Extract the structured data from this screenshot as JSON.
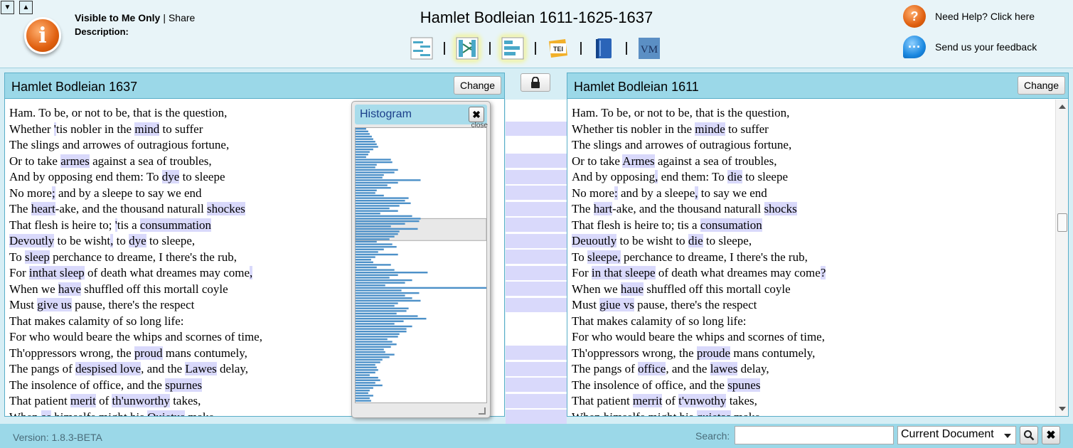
{
  "header": {
    "visibility": "Visible to Me Only",
    "share": "Share",
    "description_label": "Description:",
    "title": "Hamlet Bodleian 1611-1625-1637",
    "help": "Need Help? Click here",
    "feedback": "Send us your feedback",
    "toolbar_icons": [
      "side-by-side-icon",
      "collate-icon",
      "heatmap-icon",
      "tei-icon",
      "book-icon",
      "vm-icon"
    ],
    "tei_label": "TEI",
    "vm_label": "VM"
  },
  "left": {
    "title": "Hamlet Bodleian 1637",
    "change_label": "Change",
    "lines": [
      [
        [
          "Ham. To be, or not to be, that is the question,",
          false
        ]
      ],
      [
        [
          "Whether ",
          false
        ],
        [
          "'",
          true
        ],
        [
          "tis nobler in the ",
          false
        ],
        [
          "mind",
          true
        ],
        [
          " to suffer",
          false
        ]
      ],
      [
        [
          "The slings and arrowes of outragious fortune,",
          false
        ]
      ],
      [
        [
          "Or to take ",
          false
        ],
        [
          "armes",
          true
        ],
        [
          " against a sea of troubles,",
          false
        ]
      ],
      [
        [
          "And by opposing end them: To ",
          false
        ],
        [
          "dye",
          true
        ],
        [
          " to sleepe",
          false
        ]
      ],
      [
        [
          "No more",
          false
        ],
        [
          ";",
          true
        ],
        [
          " and by a sleepe to say we end",
          false
        ]
      ],
      [
        [
          "The ",
          false
        ],
        [
          "heart",
          true
        ],
        [
          "-ake, and the thousand naturall ",
          false
        ],
        [
          "shockes",
          true
        ]
      ],
      [
        [
          "That flesh is heire to; ",
          false
        ],
        [
          "'",
          true
        ],
        [
          "tis a ",
          false
        ],
        [
          "consummation",
          true
        ]
      ],
      [
        [
          "Devoutly",
          true
        ],
        [
          " to be wisht",
          false
        ],
        [
          ",",
          true
        ],
        [
          " to ",
          false
        ],
        [
          "dye",
          true
        ],
        [
          " to sleepe,",
          false
        ]
      ],
      [
        [
          "To ",
          false
        ],
        [
          "sleep",
          true
        ],
        [
          " perchance to dreame, I there's the rub,",
          false
        ]
      ],
      [
        [
          "For ",
          false
        ],
        [
          "inthat sleep",
          true
        ],
        [
          " of death what dreames may come",
          false
        ],
        [
          ",",
          true
        ]
      ],
      [
        [
          "When we ",
          false
        ],
        [
          "have",
          true
        ],
        [
          " shuffled off this mortall coyle",
          false
        ]
      ],
      [
        [
          "Must ",
          false
        ],
        [
          "give us",
          true
        ],
        [
          " pause, there's the respect",
          false
        ]
      ],
      [
        [
          "That makes calamity of so long life:",
          false
        ]
      ],
      [
        [
          "For who would beare the whips and scornes of time,",
          false
        ]
      ],
      [
        [
          "Th'oppressors wrong, the ",
          false
        ],
        [
          "proud",
          true
        ],
        [
          " mans contumely,",
          false
        ]
      ],
      [
        [
          "The pangs of ",
          false
        ],
        [
          "despised love",
          true
        ],
        [
          ", and the ",
          false
        ],
        [
          "Lawes",
          true
        ],
        [
          " delay,",
          false
        ]
      ],
      [
        [
          "The insolence of office, and the ",
          false
        ],
        [
          "spurnes",
          true
        ]
      ],
      [
        [
          "That patient ",
          false
        ],
        [
          "merit",
          true
        ],
        [
          " of ",
          false
        ],
        [
          "th'unworthy",
          true
        ],
        [
          " takes,",
          false
        ]
      ],
      [
        [
          "When ",
          false
        ],
        [
          "as",
          true
        ],
        [
          " himselfe might his ",
          false
        ],
        [
          "Quietus",
          true
        ],
        [
          " make",
          false
        ]
      ]
    ]
  },
  "right": {
    "title": "Hamlet Bodleian 1611",
    "change_label": "Change",
    "lines": [
      [
        [
          "Ham. To be, or not to be, that is the question,",
          false
        ]
      ],
      [
        [
          "Whether tis nobler in the ",
          false
        ],
        [
          "minde",
          true
        ],
        [
          " to suffer",
          false
        ]
      ],
      [
        [
          "The slings and arrowes of outragious fortune,",
          false
        ]
      ],
      [
        [
          "Or to take ",
          false
        ],
        [
          "Armes",
          true
        ],
        [
          " against a sea of troubles,",
          false
        ]
      ],
      [
        [
          "And by opposing",
          false
        ],
        [
          ",",
          true
        ],
        [
          " end them: To ",
          false
        ],
        [
          "die",
          true
        ],
        [
          " to sleepe",
          false
        ]
      ],
      [
        [
          "No more",
          false
        ],
        [
          ":",
          true
        ],
        [
          " and by a sleepe",
          false
        ],
        [
          ",",
          true
        ],
        [
          " to say we end",
          false
        ]
      ],
      [
        [
          "The ",
          false
        ],
        [
          "hart",
          true
        ],
        [
          "-ake, and the thousand naturall ",
          false
        ],
        [
          "shocks",
          true
        ]
      ],
      [
        [
          "That flesh is heire to; tis a ",
          false
        ],
        [
          "consumation",
          true
        ]
      ],
      [
        [
          "Deuoutly",
          true
        ],
        [
          " to be wisht to ",
          false
        ],
        [
          "die",
          true
        ],
        [
          " to sleepe,",
          false
        ]
      ],
      [
        [
          "To ",
          false
        ],
        [
          "sleepe,",
          true
        ],
        [
          " perchance to dreame, I there's the rub,",
          false
        ]
      ],
      [
        [
          "For ",
          false
        ],
        [
          "in that sleepe",
          true
        ],
        [
          " of death what dreames may come",
          false
        ],
        [
          "?",
          true
        ]
      ],
      [
        [
          "When we ",
          false
        ],
        [
          "haue",
          true
        ],
        [
          " shuffled off this mortall coyle",
          false
        ]
      ],
      [
        [
          "Must ",
          false
        ],
        [
          "giue vs",
          true
        ],
        [
          " pause, there's the respect",
          false
        ]
      ],
      [
        [
          "That makes calamity of so long life:",
          false
        ]
      ],
      [
        [
          "For who would beare the whips and scornes of time,",
          false
        ]
      ],
      [
        [
          "Th'oppressors wrong, the ",
          false
        ],
        [
          "proude",
          true
        ],
        [
          " mans contumely,",
          false
        ]
      ],
      [
        [
          "The pangs of ",
          false
        ],
        [
          "office",
          true
        ],
        [
          ", and the ",
          false
        ],
        [
          "lawes",
          true
        ],
        [
          " delay,",
          false
        ]
      ],
      [
        [
          "The insolence of office, and the ",
          false
        ],
        [
          "spunes",
          true
        ]
      ],
      [
        [
          "That patient ",
          false
        ],
        [
          "merrit",
          true
        ],
        [
          " of ",
          false
        ],
        [
          "t'vnwothy",
          true
        ],
        [
          " takes,",
          false
        ]
      ],
      [
        [
          "When himselfe might his ",
          false
        ],
        [
          "quietas",
          true
        ],
        [
          " make",
          false
        ]
      ]
    ]
  },
  "histogram": {
    "title": "Histogram",
    "close_label": "close",
    "values": [
      15,
      18,
      20,
      23,
      25,
      28,
      30,
      32,
      25,
      20,
      18,
      15,
      50,
      52,
      30,
      28,
      60,
      55,
      40,
      38,
      92,
      60,
      45,
      50,
      30,
      28,
      40,
      75,
      70,
      78,
      62,
      48,
      60,
      35,
      80,
      92,
      90,
      70,
      50,
      88,
      62,
      60,
      55,
      48,
      30,
      52,
      58,
      40,
      32,
      60,
      28,
      22,
      25,
      50,
      30,
      55,
      102,
      60,
      48,
      80,
      70,
      42,
      185,
      65,
      90,
      70,
      80,
      92,
      60,
      55,
      75,
      72,
      58,
      88,
      100,
      68,
      55,
      80,
      72,
      72,
      62,
      60,
      45,
      52,
      58,
      50,
      40,
      42,
      55,
      48,
      38,
      35,
      28,
      30,
      32,
      28,
      20,
      32,
      35,
      28,
      38,
      25,
      20,
      18,
      25,
      20,
      22
    ],
    "max": 185,
    "selection": [
      0.33,
      0.41
    ]
  },
  "center": {
    "lock_icon": "lock-icon",
    "connector_rows": [
      1,
      3,
      4,
      5,
      6,
      7,
      8,
      9,
      10,
      11,
      12,
      15,
      16,
      17,
      18,
      19
    ]
  },
  "footer": {
    "version": "Version: 1.8.3-BETA",
    "search_label": "Search:",
    "search_value": "",
    "scope": "Current Document"
  }
}
